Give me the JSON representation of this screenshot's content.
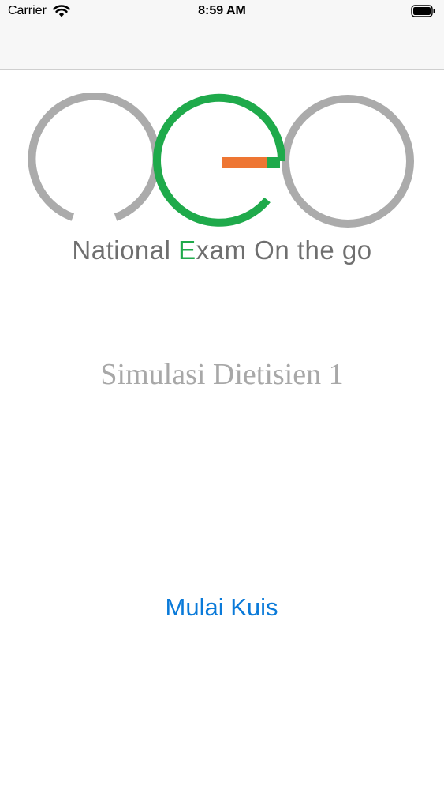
{
  "status_bar": {
    "carrier": "Carrier",
    "time": "8:59 AM"
  },
  "logo": {
    "tagline_part1": "National ",
    "tagline_accent": "E",
    "tagline_part2": "xam On the go",
    "colors": {
      "gray_ring": "#ababab",
      "green_ring": "#1faa4b",
      "orange_bar": "#ee7633"
    }
  },
  "main": {
    "title": "Simulasi Dietisien 1",
    "start_button_label": "Mulai Kuis"
  },
  "colors": {
    "accent": "#0a7ad9"
  }
}
